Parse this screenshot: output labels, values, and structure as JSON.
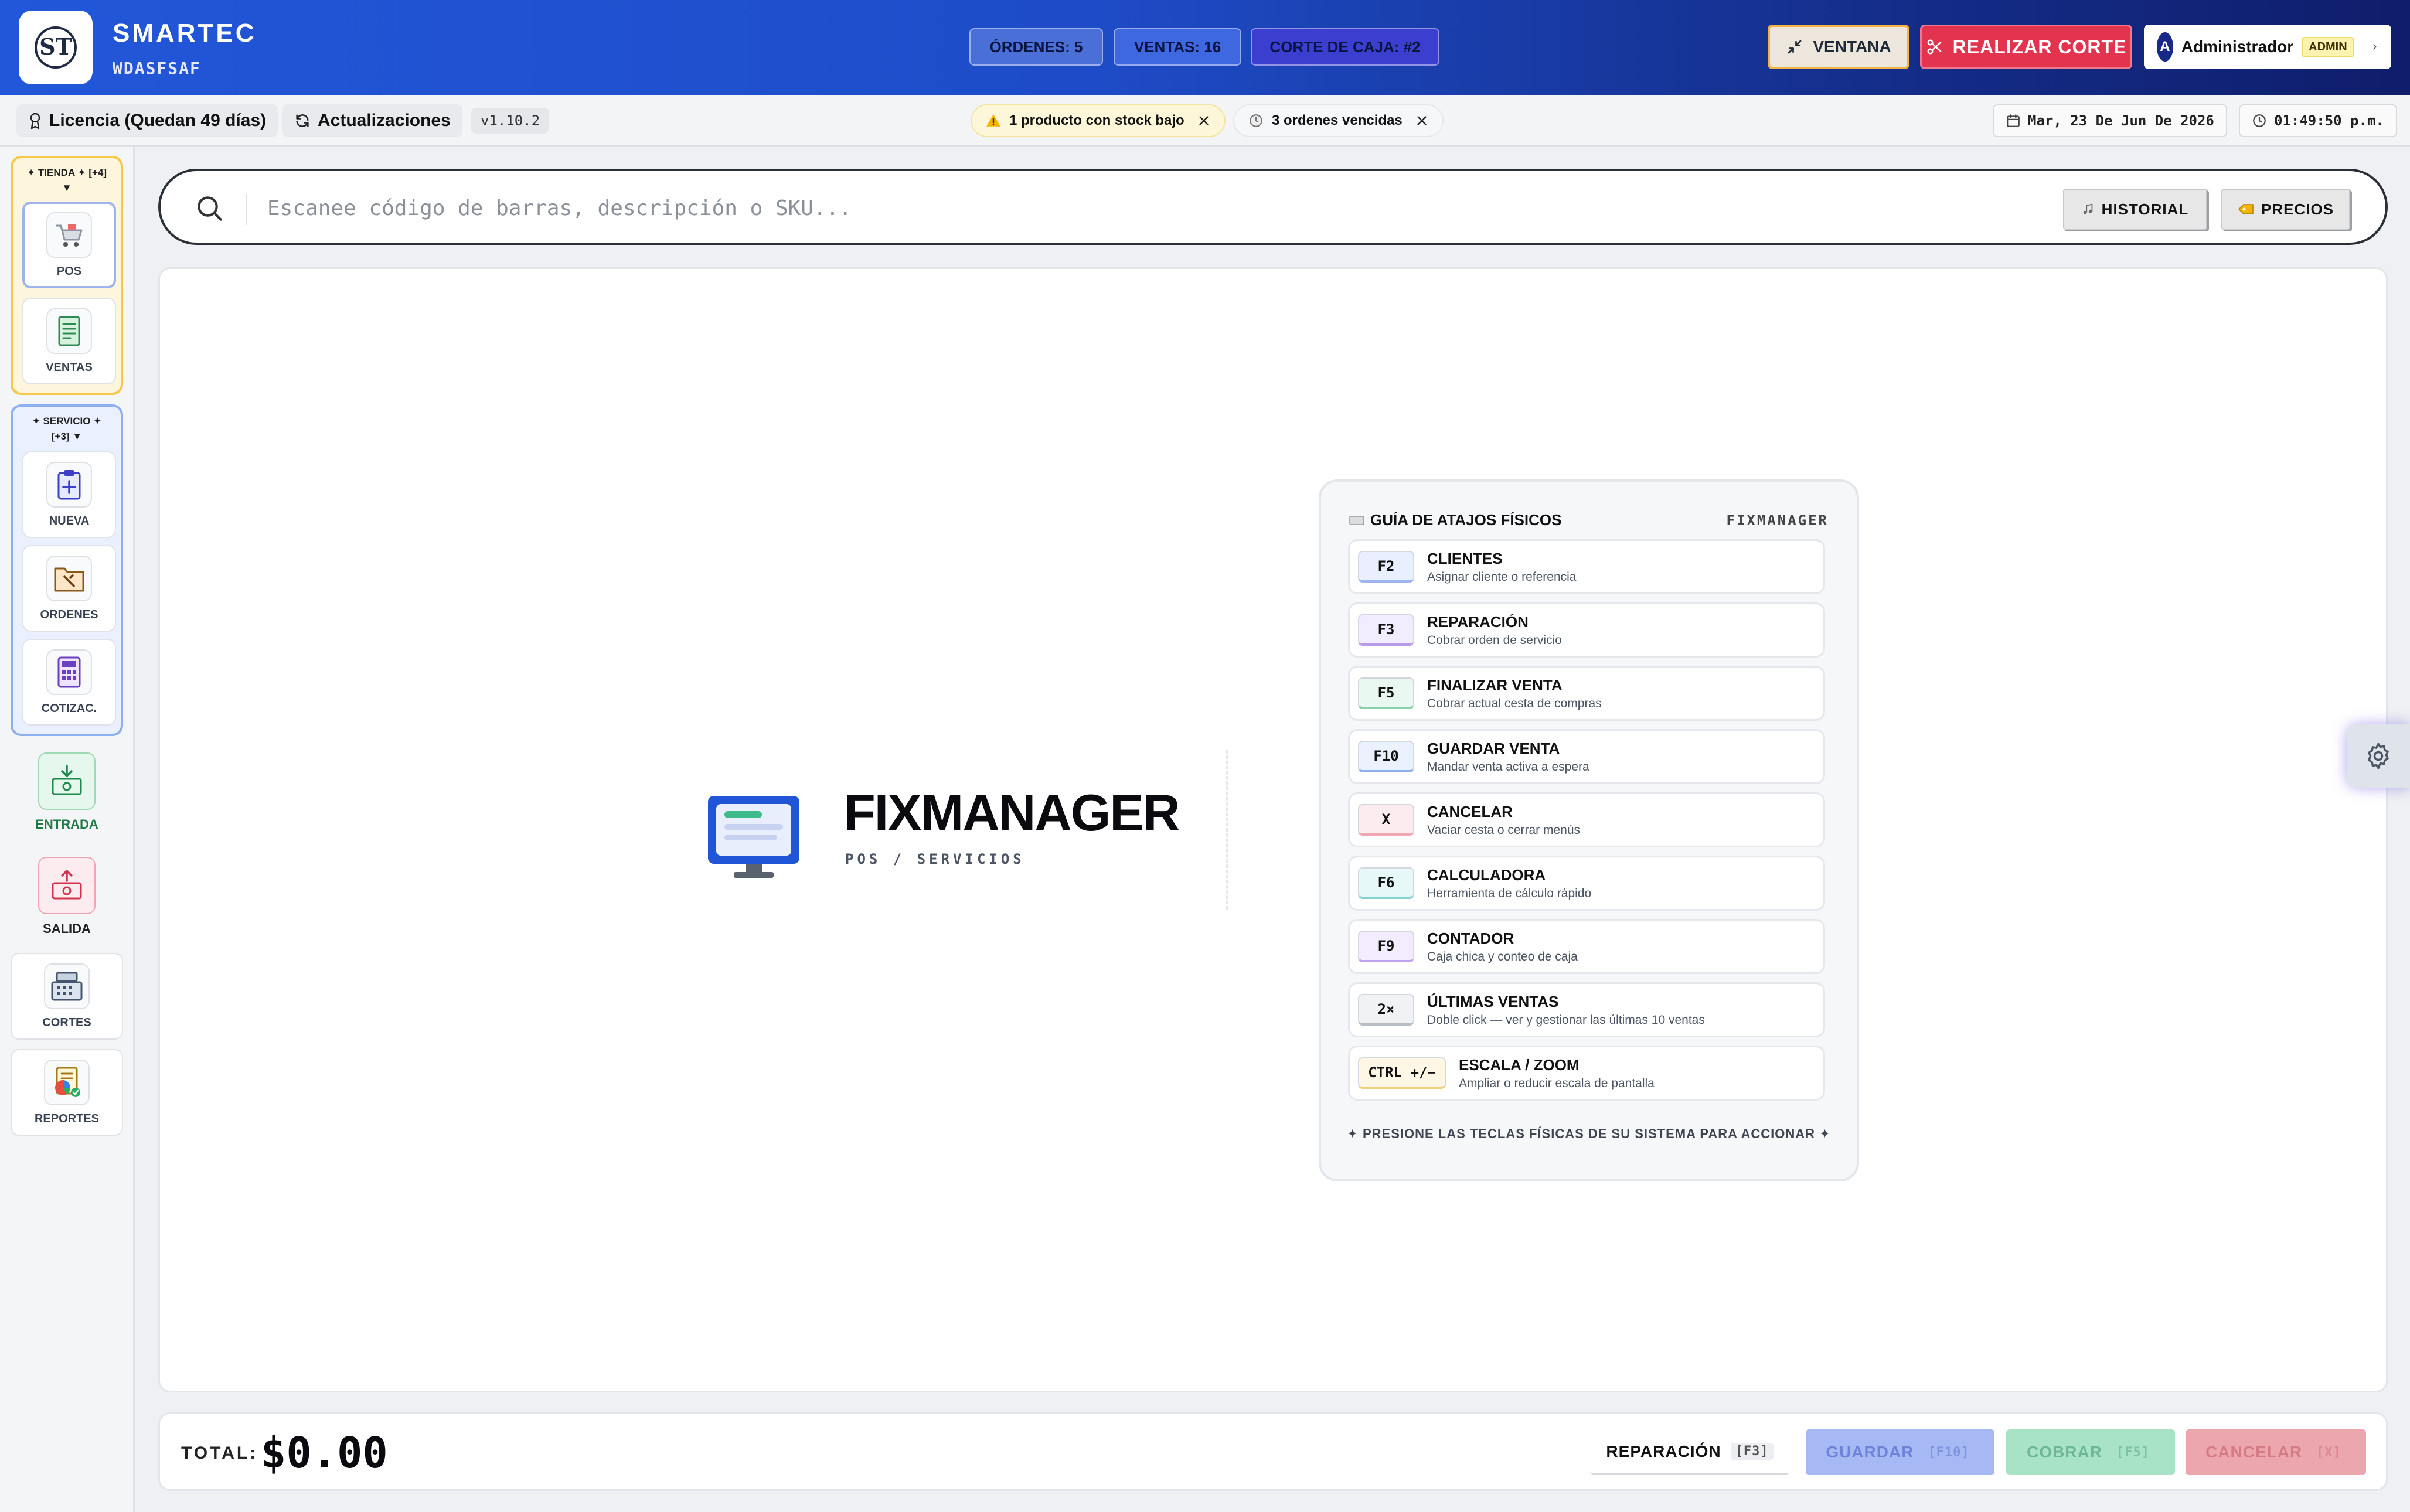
{
  "app": {
    "logo_text": "ST",
    "name": "SMARTEC",
    "subtitle": "WDASFSAF"
  },
  "header": {
    "counters": [
      {
        "label": "ÓRDENES: 5"
      },
      {
        "label": "VENTAS: 16"
      },
      {
        "label": "CORTE DE CAJA: #2"
      }
    ],
    "ventana_label": "VENTANA",
    "corte_label": "REALIZAR CORTE",
    "user": {
      "initial": "A",
      "name": "Administrador",
      "role": "ADMIN"
    }
  },
  "subbar": {
    "license": "Licencia (Quedan 49 días)",
    "updates": "Actualizaciones",
    "version": "v1.10.2",
    "alerts": [
      {
        "text": "1 producto con stock bajo",
        "icon": "warning-icon"
      },
      {
        "text": "3 ordenes vencidas",
        "icon": "clock-icon"
      }
    ],
    "date": "Mar, 23 De Jun De 2026",
    "time": "01:49:50 p.m."
  },
  "sidebar": {
    "tienda_title": "✦ TIENDA ✦ [+4] ▼",
    "tienda_items": [
      {
        "label": "POS",
        "icon": "cart-icon"
      },
      {
        "label": "VENTAS",
        "icon": "receipt-icon"
      }
    ],
    "servicio_title": "✦ SERVICIO ✦ [+3] ▼",
    "servicio_items": [
      {
        "label": "NUEVA",
        "icon": "clipboard-plus-icon"
      },
      {
        "label": "ORDENES",
        "icon": "folder-tools-icon"
      },
      {
        "label": "COTIZAC.",
        "icon": "calculator-icon"
      }
    ],
    "entrada_label": "ENTRADA",
    "salida_label": "SALIDA",
    "cortes_label": "CORTES",
    "reportes_label": "REPORTES"
  },
  "search": {
    "placeholder": "Escanee código de barras, descripción o SKU...",
    "value": "",
    "historial_label": "HISTORIAL",
    "precios_label": "PRECIOS"
  },
  "splash": {
    "title": "FIXMANAGER",
    "subtitle": "POS / SERVICIOS"
  },
  "guide": {
    "title": "GUÍA DE ATAJOS FÍSICOS",
    "brand": "FIXMANAGER",
    "shortcuts": [
      {
        "key": "F2",
        "name": "CLIENTES",
        "desc": "Asignar cliente o referencia",
        "color": "#e8f0ff"
      },
      {
        "key": "F3",
        "name": "REPARACIÓN",
        "desc": "Cobrar orden de servicio",
        "color": "#f1ecff"
      },
      {
        "key": "F5",
        "name": "FINALIZAR VENTA",
        "desc": "Cobrar actual cesta de compras",
        "color": "#e9f9f1"
      },
      {
        "key": "F10",
        "name": "GUARDAR VENTA",
        "desc": "Mandar venta activa a espera",
        "color": "#eaf1ff"
      },
      {
        "key": "X",
        "name": "CANCELAR",
        "desc": "Vaciar cesta o cerrar menús",
        "color": "#fdecef"
      },
      {
        "key": "F6",
        "name": "CALCULADORA",
        "desc": "Herramienta de cálculo rápido",
        "color": "#e6f8f8"
      },
      {
        "key": "F9",
        "name": "CONTADOR",
        "desc": "Caja chica y conteo de caja",
        "color": "#f3ecff"
      },
      {
        "key": "2×",
        "name": "ÚLTIMAS VENTAS",
        "desc": "Doble click — ver y gestionar las últimas 10 ventas",
        "color": "#f1f2f4"
      },
      {
        "key": "CTRL +/−",
        "name": "ESCALA / ZOOM",
        "desc": "Ampliar o reducir escala de pantalla",
        "color": "#fff7e6"
      }
    ],
    "footer": "✦ PRESIONE LAS TECLAS FÍSICAS DE SU SISTEMA PARA ACCIONAR ✦"
  },
  "footer": {
    "total_label": "TOTAL:",
    "total_value": "$0.00",
    "reparacion_label": "REPARACIÓN",
    "reparacion_key": "[F3]",
    "guardar_label": "GUARDAR",
    "guardar_key": "[F10]",
    "cobrar_label": "COBRAR",
    "cobrar_key": "[F5]",
    "cancelar_label": "CANCELAR",
    "cancelar_key": "[X]"
  }
}
